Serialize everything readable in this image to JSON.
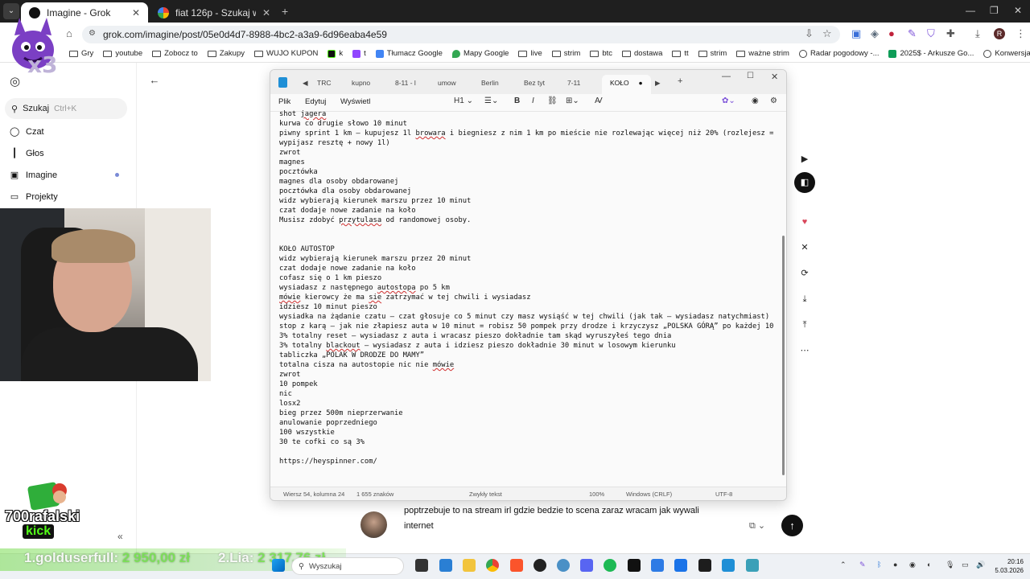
{
  "browser": {
    "tabs": [
      {
        "label": "Imagine - Grok",
        "active": true
      },
      {
        "label": "fiat 126p - Szukaj w Google",
        "active": false
      }
    ],
    "url": "grok.com/imagine/post/05e0d4d7-8988-4bc2-a3a9-6d96eaba4e59",
    "bookmarks": [
      {
        "label": "Gry",
        "icon": "folder-icon"
      },
      {
        "label": "youtube",
        "icon": "folder-icon"
      },
      {
        "label": "Zobocz to",
        "icon": "folder-icon"
      },
      {
        "label": "Zakupy",
        "icon": "folder-icon"
      },
      {
        "label": "WUJO KUPON",
        "icon": "folder-icon"
      },
      {
        "label": "k",
        "icon": "kick-icon"
      },
      {
        "label": "t",
        "icon": "twitch-icon"
      },
      {
        "label": "Tłumacz Google",
        "icon": "translate-icon"
      },
      {
        "label": "Mapy Google",
        "icon": "maps-icon"
      },
      {
        "label": "live",
        "icon": "folder-icon"
      },
      {
        "label": "strim",
        "icon": "folder-icon"
      },
      {
        "label": "btc",
        "icon": "folder-icon"
      },
      {
        "label": "dostawa",
        "icon": "folder-icon"
      },
      {
        "label": "tt",
        "icon": "folder-icon"
      },
      {
        "label": "strim",
        "icon": "folder-icon"
      },
      {
        "label": "ważne strim",
        "icon": "folder-icon"
      },
      {
        "label": "Radar pogodowy -...",
        "icon": "globe-icon"
      },
      {
        "label": "2025$ - Arkusze Go...",
        "icon": "sheets-icon"
      },
      {
        "label": "Konwersja Godzin d...",
        "icon": "globe-icon"
      }
    ]
  },
  "sidebar": {
    "search_label": "Szukaj",
    "search_hint": "Ctrl+K",
    "items": [
      {
        "label": "Czat",
        "icon": "chat-icon"
      },
      {
        "label": "Głos",
        "icon": "voice-icon"
      },
      {
        "label": "Imagine",
        "icon": "imagine-icon"
      },
      {
        "label": "Projekty",
        "icon": "folder-icon"
      }
    ]
  },
  "notepad": {
    "tabs": [
      "TRC",
      "kupno",
      "8-11 - l",
      "umow",
      "Berlin",
      "Bez tyt",
      "7-11",
      "KOŁO"
    ],
    "active_tab": "KOŁO",
    "menu": [
      "Plik",
      "Edytuj",
      "Wyświetl"
    ],
    "heading_selector": "H1",
    "lines": [
      "shot jagera",
      "kurwa co drugie słowo 10 minut",
      "piwny sprint 1 km – kupujesz 1l browara i biegniesz z nim 1 km po mieście nie rozlewając więcej niż 20% (rozlejesz =",
      "wypijasz resztę + nowy 1l)",
      "zwrot",
      "magnes",
      "pocztówka",
      "magnes dla osoby obdarowanej",
      "pocztówka dla osoby obdarowanej",
      "widz wybierają kierunek marszu przez 10 minut",
      "czat dodaje nowe zadanie na koło",
      "Musisz zdobyć przytulasa od randomowej osoby.",
      "",
      "",
      "KOŁO AUTOSTOP",
      "widz wybierają kierunek marszu przez 20 minut",
      "czat dodaje nowe zadanie na koło",
      "cofasz się o 1 km pieszo",
      "wysiadasz z następnego autostopa po 5 km",
      "mówie kierowcy że ma sie zatrzymać w tej chwili i wysiadasz",
      "idziesz 10 minut pieszo",
      "wysiadka na żądanie czatu – czat głosuje co 5 minut czy masz wysiąść w tej chwili (jak tak – wysiadasz natychmiast)",
      "stop z karą – jak nie złapiesz auta w 10 minut = robisz 50 pompek przy drodze i krzyczysz „POLSKA GÓRĄ” po każdej 10",
      "3% totalny reset – wysiadasz z auta i wracasz pieszo dokładnie tam skąd wyruszyłeś tego dnia",
      "3% totalny blackout – wysiadasz z auta i idziesz pieszo dokładnie 30 minut w losowym kierunku",
      "tabliczka „POLAK W DRODZE DO MAMY”",
      "totalna cisza na autostopie nic nie mówie",
      "zwrot",
      "10 pompek",
      "nic",
      "losx2",
      "bieg przez 500m nieprzerwanie",
      "anulowanie poprzedniego",
      "100 wszystkie",
      "30 te cofki co są 3%",
      "",
      "https://heyspinner.com/"
    ],
    "status": {
      "position": "Wiersz 54, kolumna 24",
      "chars": "1 655 znaków",
      "format": "Zwykły tekst",
      "zoom": "100%",
      "eol": "Windows (CRLF)",
      "encoding": "UTF-8"
    }
  },
  "prompt": {
    "text": "poptrzebuje to na stream irl gdzie bedzie to scena zaraz wracam jak wywali internet"
  },
  "overlay": {
    "channel": "700rafalski",
    "platform": "kick",
    "top1_name": "1.golduserfull:",
    "top1_amount": "2 950,00 zł",
    "top2_name": "2.Lia:",
    "top2_amount": "2 317,76 zł",
    "mascot_badge": "x3"
  },
  "taskbar": {
    "search_label": "Wyszukaj",
    "time": "20:16",
    "date": "5.03.2026"
  },
  "colors": {
    "kick_green": "#53fc18",
    "send_button": "#111111",
    "favorite": "#d9475b"
  }
}
